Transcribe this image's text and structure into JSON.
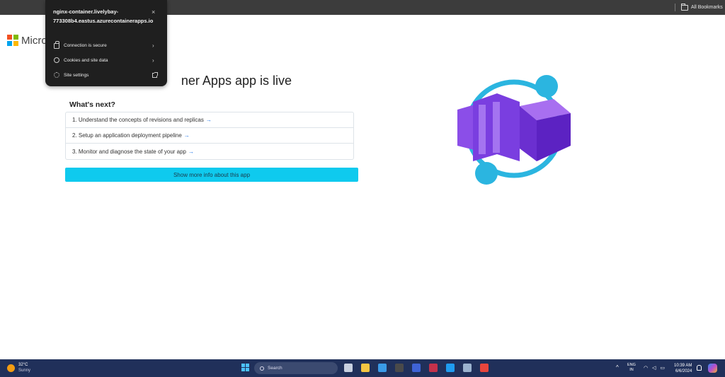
{
  "bookmarks_bar": {
    "all_bookmarks_label": "All Bookmarks"
  },
  "header": {
    "brand_text": "Micro"
  },
  "main": {
    "title": "ner Apps app is live",
    "whats_next_heading": "What's next?",
    "next_items": [
      {
        "label": "1. Understand the concepts of revisions and replicas",
        "arrow": "→"
      },
      {
        "label": "2. Setup an application deployment pipeline",
        "arrow": "→"
      },
      {
        "label": "3. Monitor and diagnose the state of your app",
        "arrow": "→"
      }
    ],
    "more_info_button": "Show more info about this app"
  },
  "site_info_popup": {
    "hostname": "nginx-container.livelybay-773308b4.eastus.azurecontainerapps.io",
    "close_icon": "×",
    "rows": [
      {
        "label": "Connection is secure",
        "icon": "lock-icon",
        "chevron": "›"
      },
      {
        "label": "Cookies and site data",
        "icon": "cookie-icon",
        "chevron": "›"
      },
      {
        "label": "Site settings",
        "icon": "gear-icon"
      }
    ]
  },
  "illustration": {
    "name": "container-apps-illustration",
    "colors": {
      "ring": "#2bb5e0",
      "cube_light": "#a86ff0",
      "cube_dark": "#6b2fd0",
      "dot": "#2bb5e0"
    }
  },
  "taskbar": {
    "weather_temp": "32°C",
    "weather_condition": "Sunny",
    "search_label": "Search",
    "language_line1": "ENG",
    "language_line2": "IN",
    "time": "10:39 AM",
    "date": "6/6/2024",
    "apps": [
      {
        "name": "task-view-icon",
        "color": "#c8d0e0"
      },
      {
        "name": "file-explorer-icon",
        "color": "#f5c542"
      },
      {
        "name": "store-icon",
        "color": "#3a9be8"
      },
      {
        "name": "app-dark-icon",
        "color": "#4a4a4a"
      },
      {
        "name": "app-blue-icon",
        "color": "#3f63d6"
      },
      {
        "name": "app-red-icon",
        "color": "#c4314b"
      },
      {
        "name": "vscode-icon",
        "color": "#1f9cf0"
      },
      {
        "name": "app-shield-icon",
        "color": "#9bb3cf"
      },
      {
        "name": "chrome-icon",
        "color": "#e8453c"
      }
    ]
  }
}
